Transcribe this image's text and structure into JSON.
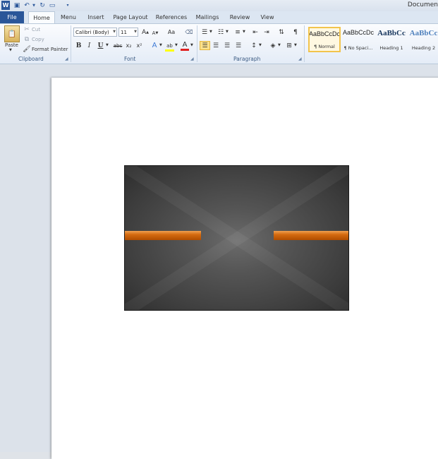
{
  "title_bar": {
    "document_title": "Documen",
    "qat": {
      "word_icon": "word-icon",
      "save_icon": "save-icon",
      "undo_icon": "undo-icon",
      "redo_icon": "redo-icon",
      "new_icon": "new-document-icon",
      "customize_icon": "customize-qat-icon"
    }
  },
  "tabs": [
    {
      "label": "File"
    },
    {
      "label": "Home",
      "active": true
    },
    {
      "label": "Menu"
    },
    {
      "label": "Insert"
    },
    {
      "label": "Page Layout"
    },
    {
      "label": "References"
    },
    {
      "label": "Mailings"
    },
    {
      "label": "Review"
    },
    {
      "label": "View"
    }
  ],
  "clipboard": {
    "paste_label": "Paste",
    "cut_label": "Cut",
    "copy_label": "Copy",
    "format_painter_label": "Format Painter",
    "group_label": "Clipboard"
  },
  "font": {
    "font_name": "Calibri (Body)",
    "font_size": "11",
    "bold": "B",
    "italic": "I",
    "underline": "U",
    "strikethrough": "abc",
    "subscript": "x₂",
    "superscript": "x²",
    "grow": "A",
    "shrink": "A",
    "change_case": "Aa",
    "font_color": "A",
    "highlight": "ab",
    "group_label": "Font"
  },
  "paragraph": {
    "pilcrow": "¶",
    "group_label": "Paragraph"
  },
  "styles": [
    {
      "sample": "AaBbCcDc",
      "name": "¶ Normal",
      "selected": true
    },
    {
      "sample": "AaBbCcDc",
      "name": "¶ No Spaci..."
    },
    {
      "sample": "AaBbCc",
      "name": "Heading 1"
    },
    {
      "sample": "AaBbCc",
      "name": "Heading 2"
    }
  ],
  "colors": {
    "file_tab": "#2a5699",
    "accent_bar": "#d46a10",
    "picture_bg": "#3c3c3c"
  }
}
